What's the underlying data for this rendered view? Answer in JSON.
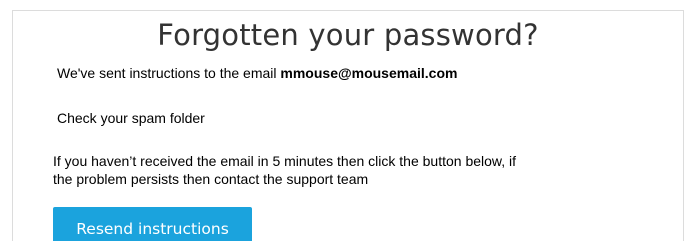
{
  "page": {
    "title": "Forgotten your password?",
    "sent_prefix": "We've sent instructions to the email ",
    "email": "mmouse@mousemail.com",
    "spam_notice": "Check your spam folder",
    "info_line_1": "If you haven’t received the email in 5 minutes then click the button below, if",
    "info_line_2": "the problem persists then contact the support team",
    "resend_button_label": "Resend instructions"
  },
  "colors": {
    "button_background": "#1ba3dd",
    "button_text": "#ffffff",
    "title_text": "#333333",
    "card_border": "#dcdcdc"
  }
}
